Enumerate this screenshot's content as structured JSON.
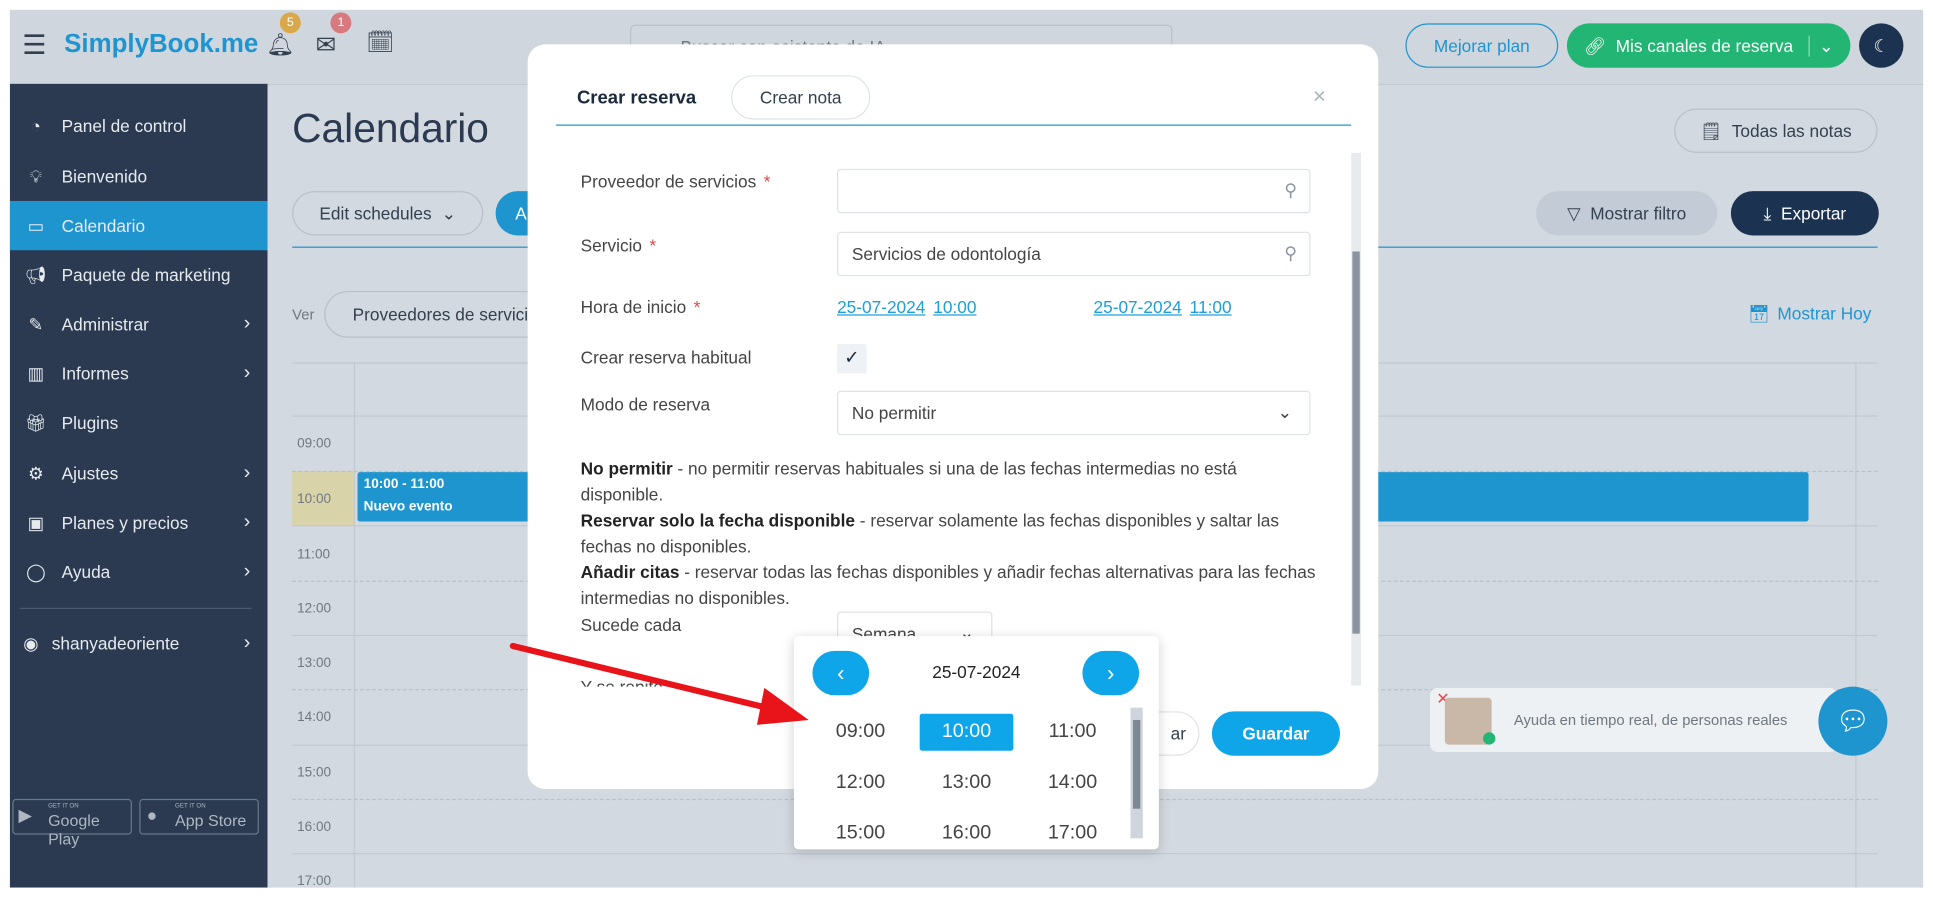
{
  "topbar": {
    "logo": "SimplyBook.me",
    "notifications_count": "5",
    "messages_count": "1",
    "search_placeholder": "Buscar con asistente de IA",
    "upgrade_label": "Mejorar plan",
    "channels_label": "Mis canales de reserva",
    "colors": {
      "accent": "#1e95cf",
      "green": "#22b573",
      "badge_yellow": "#d9a84a",
      "badge_red": "#d67a80"
    }
  },
  "sidebar": {
    "items": [
      {
        "label": "Panel de control",
        "icon": "dashboard-icon",
        "chevron": false
      },
      {
        "label": "Bienvenido",
        "icon": "lightbulb-icon",
        "chevron": false
      },
      {
        "label": "Calendario",
        "icon": "calendar-icon",
        "chevron": false,
        "active": true
      },
      {
        "label": "Paquete de marketing",
        "icon": "megaphone-icon",
        "chevron": false
      },
      {
        "label": "Administrar",
        "icon": "pencil-icon",
        "chevron": true
      },
      {
        "label": "Informes",
        "icon": "bar-chart-icon",
        "chevron": true
      },
      {
        "label": "Plugins",
        "icon": "gift-icon",
        "chevron": false
      },
      {
        "label": "Ajustes",
        "icon": "gear-icon",
        "chevron": true
      },
      {
        "label": "Planes y precios",
        "icon": "money-icon",
        "chevron": true
      },
      {
        "label": "Ayuda",
        "icon": "chat-icon",
        "chevron": true
      }
    ],
    "user": "shanyadeoriente",
    "google_play": {
      "small": "GET IT ON",
      "label": "Google Play"
    },
    "app_store": {
      "small": "GET IT ON",
      "label": "App Store"
    }
  },
  "main": {
    "title": "Calendario",
    "all_notes": "Todas las notas",
    "edit_schedules": "Edit schedules",
    "tab_partial": "A",
    "show_filter": "Mostrar filtro",
    "export": "Exportar",
    "view_label": "Ver",
    "view_select": "Proveedores de servicio",
    "show_today": "Mostrar Hoy",
    "times": [
      "09:00",
      "10:00",
      "11:00",
      "12:00",
      "13:00",
      "14:00",
      "15:00",
      "16:00",
      "17:00"
    ],
    "event": {
      "time": "10:00 - 11:00",
      "title": "Nuevo evento"
    }
  },
  "modal": {
    "tab_active": "Crear reserva",
    "tab_other": "Crear nota",
    "provider_label": "Proveedor de servicios",
    "provider_value": "",
    "service_label": "Servicio",
    "service_value": "Servicios de odontología",
    "start_label": "Hora de inicio",
    "start_date": "25-07-2024",
    "start_time": "10:00",
    "end_date": "25-07-2024",
    "end_time": "11:00",
    "recurring_label": "Crear reserva habitual",
    "recurring_checked": true,
    "mode_label": "Modo de reserva",
    "mode_value": "No permitir",
    "desc": [
      {
        "bold": "No permitir",
        "text": " - no permitir reservas habituales si una de las fechas intermedias no está disponible."
      },
      {
        "bold": "Reservar solo la fecha disponible",
        "text": " - reservar solamente las fechas disponibles y saltar las fechas no disponibles."
      },
      {
        "bold": "Añadir citas",
        "text": " - reservar todas las fechas disponibles y añadir fechas alternativas para las fechas intermedias no disponibles."
      }
    ],
    "repeat_label": "Sucede cada",
    "repeat_value": "Semana",
    "repeat_more_label": "Y se repite",
    "cancel_partial": "ar",
    "save": "Guardar"
  },
  "picker": {
    "date": "25-07-2024",
    "slots": [
      "09:00",
      "10:00",
      "11:00",
      "12:00",
      "13:00",
      "14:00",
      "15:00",
      "16:00",
      "17:00"
    ],
    "selected": "10:00"
  },
  "chat": {
    "text": "Ayuda en tiempo real, de personas reales"
  }
}
